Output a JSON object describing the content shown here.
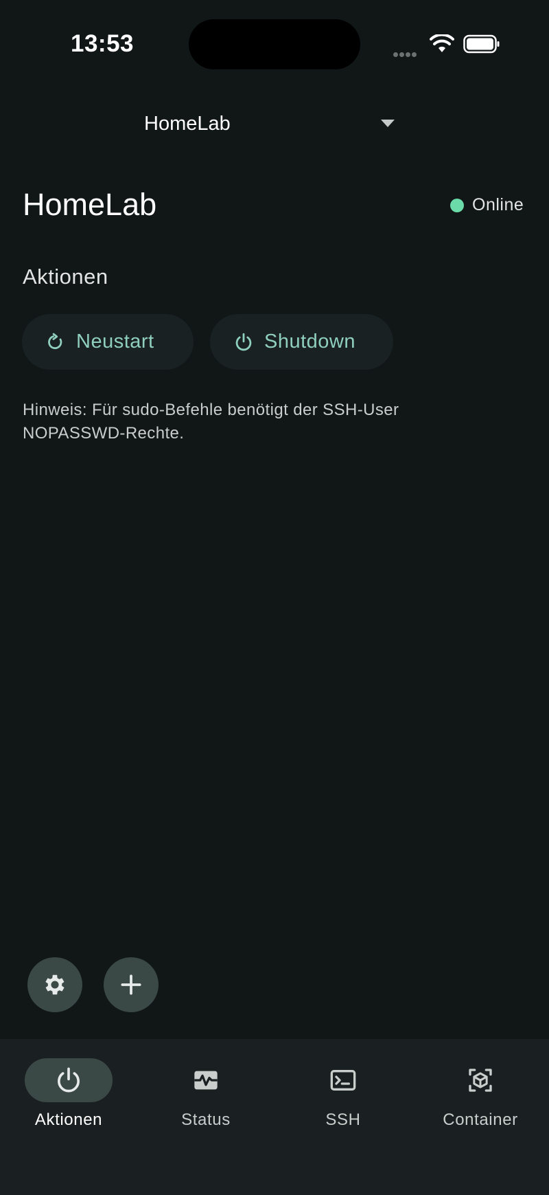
{
  "status_bar": {
    "time": "13:53"
  },
  "header": {
    "server_name": "HomeLab"
  },
  "server": {
    "title": "HomeLab",
    "status": "Online",
    "status_color": "#6bdba9"
  },
  "actions": {
    "section_title": "Aktionen",
    "restart_label": "Neustart",
    "shutdown_label": "Shutdown",
    "hint": "Hinweis: Für sudo-Befehle benötigt der SSH-User NOPASSWD-Rechte."
  },
  "fabs": [
    {
      "icon": "gear-icon"
    },
    {
      "icon": "plus-icon"
    }
  ],
  "bottom_nav": {
    "items": [
      {
        "label": "Aktionen",
        "icon": "power-icon",
        "active": true
      },
      {
        "label": "Status",
        "icon": "activity-icon",
        "active": false
      },
      {
        "label": "SSH",
        "icon": "terminal-icon",
        "active": false
      },
      {
        "label": "Container",
        "icon": "container-icon",
        "active": false
      }
    ]
  },
  "colors": {
    "accent": "#8fcfbf",
    "background": "#111617",
    "surface": "#1a2122",
    "active_pill": "#3a4846"
  }
}
